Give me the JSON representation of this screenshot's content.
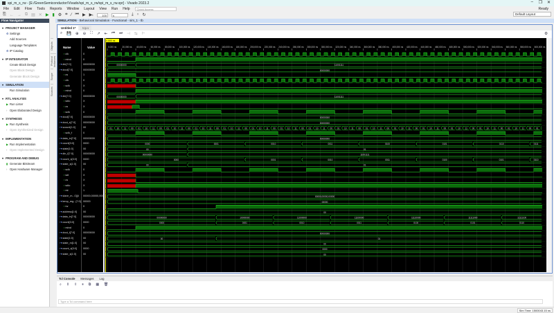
{
  "window": {
    "title": "spi_m_s_rw - [E:/GreenSemiconductor/Vivado/spi_m_s_rw/spi_m_s_rw.xpr] - Vivado 2023.2",
    "status": "Ready"
  },
  "menu": [
    "File",
    "Edit",
    "Flow",
    "Tools",
    "Reports",
    "Window",
    "Layout",
    "View",
    "Run",
    "Help"
  ],
  "quick_access": "Quick Access",
  "toolbar": {
    "run_time": "100",
    "run_unit": "s"
  },
  "layout_select": "Default Layout",
  "flow_navigator": {
    "title": "Flow Navigator",
    "sections": [
      {
        "label": "PROJECT MANAGER",
        "items": [
          {
            "label": "Settings",
            "icon": "gear"
          },
          {
            "label": "Add Sources"
          },
          {
            "label": "Language Templates"
          },
          {
            "label": "IP Catalog",
            "icon": "ip"
          }
        ]
      },
      {
        "label": "IP INTEGRATOR",
        "items": [
          {
            "label": "Create Block Design"
          },
          {
            "label": "Open Block Design",
            "disabled": true
          },
          {
            "label": "Generate Block Design",
            "disabled": true
          }
        ]
      },
      {
        "label": "SIMULATION",
        "selected": true,
        "items": [
          {
            "label": "Run Simulation"
          }
        ]
      },
      {
        "label": "RTL ANALYSIS",
        "items": [
          {
            "label": "Run Linter",
            "icon": "play"
          },
          {
            "label": "Open Elaborated Design",
            "icon": "chevron"
          }
        ]
      },
      {
        "label": "SYNTHESIS",
        "items": [
          {
            "label": "Run Synthesis",
            "icon": "play"
          },
          {
            "label": "Open Synthesized Design",
            "icon": "chevron",
            "disabled": true
          }
        ]
      },
      {
        "label": "IMPLEMENTATION",
        "items": [
          {
            "label": "Run Implementation",
            "icon": "play"
          },
          {
            "label": "Open Implemented Design",
            "icon": "chevron",
            "disabled": true
          }
        ]
      },
      {
        "label": "PROGRAM AND DEBUG",
        "items": [
          {
            "label": "Generate Bitstream",
            "icon": "bitstream"
          },
          {
            "label": "Open Hardware Manager",
            "icon": "chevron"
          }
        ]
      }
    ]
  },
  "side_tabs": [
    "Objects",
    "Protocol Instances",
    "Scope",
    "Sources"
  ],
  "sim_header": {
    "title": "SIMULATION",
    "path": " - Behavioral Simulation - Functional - sim_1 - tb"
  },
  "wave_tabs": [
    "Untitled 1*",
    "tcp.v"
  ],
  "wave": {
    "name_header": "Name",
    "value_header": "Value",
    "cursor": "0.000 ns",
    "time_end_ns": 612000,
    "tick_step_ns": 20000,
    "tick_unit": " ns",
    "signals": [
      {
        "name": "clk",
        "value": "0",
        "kind": "clock",
        "period": 10000,
        "offset": 0
      },
      {
        "name": "rstnd",
        "value": "0",
        "kind": "bit",
        "edges": [
          [
            0,
            0
          ],
          [
            40000,
            1
          ]
        ]
      },
      {
        "name": "din[7:0]",
        "value": "00000000",
        "kind": "bus",
        "segs": [
          [
            0,
            40000,
            "00000000"
          ],
          [
            40000,
            612000,
            "11001111"
          ]
        ]
      },
      {
        "name": "dout[7:0]",
        "value": "00000000",
        "kind": "bus",
        "segs": [
          [
            0,
            612000,
            "00000000"
          ]
        ]
      },
      {
        "name": "cs",
        "value": "1",
        "kind": "bit",
        "edges": [
          [
            0,
            1
          ],
          [
            40000,
            0
          ]
        ]
      },
      {
        "name": "clk",
        "value": "0",
        "kind": "clock",
        "period": 10000,
        "offset": 0
      },
      {
        "name": "sclk",
        "value": "X",
        "kind": "bit",
        "edges": [
          [
            0,
            "x"
          ],
          [
            40000,
            0
          ]
        ]
      },
      {
        "name": "rstnd",
        "value": "0",
        "kind": "bit",
        "edges": [
          [
            0,
            0
          ],
          [
            40000,
            1
          ]
        ]
      },
      {
        "name": "din[7:0]",
        "value": "00000000",
        "kind": "bus",
        "segs": [
          [
            0,
            40000,
            "00000000"
          ],
          [
            40000,
            612000,
            "11001111"
          ]
        ]
      },
      {
        "name": "sdio",
        "value": "X",
        "kind": "bit",
        "edges": [
          [
            0,
            "x"
          ],
          [
            40000,
            1
          ]
        ]
      },
      {
        "name": "cs",
        "value": "X",
        "kind": "bit",
        "edges": [
          [
            0,
            "x"
          ],
          [
            35000,
            1
          ],
          [
            45000,
            0
          ]
        ]
      },
      {
        "name": "sclk",
        "value": "0",
        "kind": "clock",
        "period": 80000,
        "offset": 40000
      },
      {
        "name": "dout[7:0]",
        "value": "00000000",
        "kind": "bus",
        "segs": [
          [
            0,
            612000,
            "00000000"
          ]
        ]
      },
      {
        "name": "dout_s[7:0]",
        "value": "00000000",
        "kind": "bus",
        "segs": [
          [
            0,
            612000,
            "00000000"
          ]
        ]
      },
      {
        "name": "scount[1:0]",
        "value": "00",
        "kind": "counter",
        "period": 10000,
        "labels": [
          "01",
          "10",
          "11",
          "00"
        ]
      },
      {
        "name": "sclk_f",
        "value": "0",
        "kind": "clock",
        "period": 80000,
        "offset": 40000
      },
      {
        "name": "data_in[7:0]",
        "value": "00000000",
        "kind": "bus",
        "segs": [
          [
            0,
            612000,
            "00000000"
          ]
        ]
      },
      {
        "name": "count[3:0]",
        "value": "0000",
        "kind": "bus",
        "segs": [
          [
            0,
            112800,
            "0000"
          ],
          [
            112800,
            193700,
            "0001"
          ],
          [
            193700,
            273700,
            "0010"
          ],
          [
            273700,
            353700,
            "0011"
          ],
          [
            353700,
            434700,
            "0100"
          ],
          [
            434700,
            514700,
            "0101"
          ],
          [
            514700,
            594700,
            "0110"
          ],
          [
            594700,
            612000,
            "0111"
          ]
        ]
      },
      {
        "name": "state[1:0]",
        "value": "00",
        "kind": "bus",
        "segs": [
          [
            0,
            112800,
            "00"
          ],
          [
            112800,
            612000,
            "01"
          ]
        ]
      },
      {
        "name": "din_f[7:0]",
        "value": "00000000",
        "kind": "bus",
        "segs": [
          [
            0,
            112800,
            "00000000"
          ],
          [
            112800,
            612000,
            "11001111"
          ]
        ]
      },
      {
        "name": "count_s[3:0]",
        "value": "0000",
        "kind": "bus",
        "segs": [
          [
            0,
            193700,
            "0000"
          ],
          [
            193700,
            273700,
            "0001"
          ],
          [
            273700,
            353700,
            "0010"
          ],
          [
            353700,
            434700,
            "0011"
          ],
          [
            434700,
            514700,
            "0100"
          ],
          [
            514700,
            594700,
            "0101"
          ],
          [
            594700,
            612000,
            "0110"
          ]
        ]
      },
      {
        "name": "state_s[1:0]",
        "value": "00",
        "kind": "bus",
        "segs": [
          [
            0,
            112800,
            "00"
          ],
          [
            112800,
            612000,
            "01"
          ]
        ]
      },
      {
        "name": "sclk",
        "value": "0",
        "kind": "clock",
        "period": 80000,
        "offset": 40000
      },
      {
        "name": "sdi",
        "value": "X",
        "kind": "bit",
        "edges": [
          [
            0,
            "x"
          ],
          [
            40000,
            0
          ]
        ]
      },
      {
        "name": "cs",
        "value": "X",
        "kind": "bit",
        "edges": [
          [
            0,
            "x"
          ],
          [
            40000,
            0
          ]
        ]
      },
      {
        "name": "sdio",
        "value": "X",
        "kind": "bit",
        "edges": [
          [
            0,
            "x"
          ],
          [
            40000,
            1
          ]
        ]
      },
      {
        "name": "rst",
        "value": "1",
        "kind": "bit",
        "edges": [
          [
            0,
            1
          ],
          [
            43000,
            0
          ]
        ]
      },
      {
        "name": "slave_m...0][4",
        "value": "00000,00000,0000..",
        "kind": "bus",
        "segs": [
          [
            0,
            612000,
            "00000,00000,00000"
          ]
        ]
      },
      {
        "name": "temp_reg...[7:0]",
        "value": "00000",
        "kind": "bus",
        "segs": [
          [
            0,
            612000,
            "00000"
          ]
        ]
      },
      {
        "name": "rw",
        "value": "0",
        "kind": "bit",
        "edges": [
          [
            0,
            0
          ],
          [
            153000,
            1
          ]
        ]
      },
      {
        "name": "address[1:0]",
        "value": "00",
        "kind": "bus",
        "segs": [
          [
            0,
            612000,
            "00"
          ]
        ]
      },
      {
        "name": "data_in[7:0]",
        "value": "00000000",
        "kind": "bus",
        "segs": [
          [
            0,
            153000,
            "00000000"
          ],
          [
            153000,
            233600,
            "10000000"
          ],
          [
            233600,
            313900,
            "11000000"
          ],
          [
            313900,
            394700,
            "11100000"
          ],
          [
            394700,
            474000,
            "11110000"
          ],
          [
            474000,
            554800,
            "11111000"
          ],
          [
            554800,
            612000,
            "11111100"
          ]
        ]
      },
      {
        "name": "count[3:0]",
        "value": "0000",
        "kind": "bus",
        "segs": [
          [
            0,
            153000,
            "0000"
          ],
          [
            153000,
            233600,
            "0001"
          ],
          [
            233600,
            313900,
            "0010"
          ],
          [
            313900,
            394700,
            "0011"
          ],
          [
            394700,
            474000,
            "0100"
          ],
          [
            474000,
            554800,
            "0101"
          ],
          [
            554800,
            612000,
            "0110"
          ]
        ]
      },
      {
        "name": "rstnd",
        "value": "0",
        "kind": "bit",
        "edges": [
          [
            0,
            0
          ],
          [
            40000,
            1
          ]
        ]
      },
      {
        "name": "dout_t[7:0]",
        "value": "00000000",
        "kind": "bus",
        "segs": [
          [
            0,
            612000,
            "00000000"
          ]
        ]
      },
      {
        "name": "state[1:0]",
        "value": "00",
        "kind": "bus",
        "segs": [
          [
            0,
            153000,
            "00"
          ],
          [
            153000,
            612000,
            "01"
          ]
        ]
      },
      {
        "name": "state_m[1:0]",
        "value": "00",
        "kind": "bus",
        "segs": [
          [
            0,
            612000,
            "00"
          ]
        ]
      },
      {
        "name": "count_s[3:0]",
        "value": "0000",
        "kind": "bus",
        "segs": [
          [
            0,
            612000,
            "0000"
          ]
        ]
      },
      {
        "name": "state_s[1:0]",
        "value": "00",
        "kind": "bus",
        "segs": [
          [
            0,
            612000,
            "00"
          ]
        ]
      }
    ]
  },
  "console": {
    "tabs": [
      "Tcl Console",
      "Messages",
      "Log"
    ],
    "placeholder": "Type a Tcl command here"
  },
  "status": {
    "sim_time": "Sim Time: 1500043.15 ns"
  },
  "colors": {
    "wave": "#1fbf1f",
    "wave_fill": "#0b6b0b",
    "x": "#c00000",
    "cursor": "#ffff00",
    "selection": "#cfe0f7"
  }
}
